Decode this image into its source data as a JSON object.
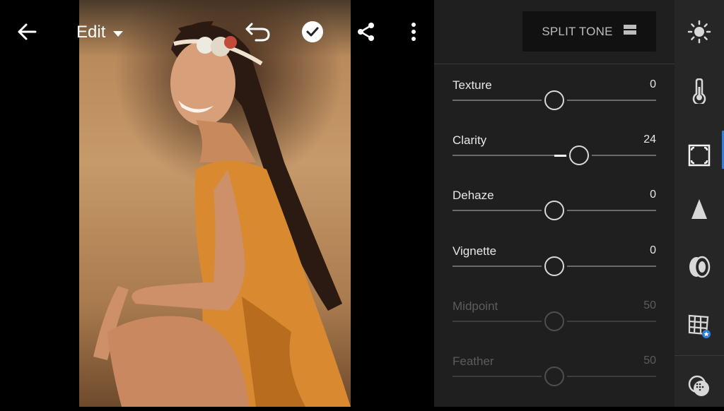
{
  "topbar": {
    "edit_label": "Edit",
    "icons": [
      "back-arrow-icon",
      "chevron-down-icon",
      "undo-icon",
      "checkmark-icon",
      "share-icon",
      "more-vertical-icon"
    ]
  },
  "panel": {
    "split_tone_label": "SPLIT TONE",
    "sliders": [
      {
        "label": "Texture",
        "value": "0",
        "level": 0.5,
        "enabled": true
      },
      {
        "label": "Clarity",
        "value": "24",
        "level": 0.62,
        "enabled": true
      },
      {
        "label": "Dehaze",
        "value": "0",
        "level": 0.5,
        "enabled": true
      },
      {
        "label": "Vignette",
        "value": "0",
        "level": 0.5,
        "enabled": true
      },
      {
        "label": "Midpoint",
        "value": "50",
        "level": 0.5,
        "enabled": false
      },
      {
        "label": "Feather",
        "value": "50",
        "level": 0.5,
        "enabled": false
      }
    ]
  },
  "toolstrip": {
    "items": [
      "light-icon",
      "color-temperature-icon",
      "effects-icon",
      "detail-icon",
      "optics-icon",
      "geometry-icon",
      "selective-mask-icon"
    ],
    "active": "effects-icon"
  },
  "colors": {
    "panel_bg": "#1f1f1f",
    "toolstrip_bg": "#262626",
    "accent": "#2f7de1"
  }
}
